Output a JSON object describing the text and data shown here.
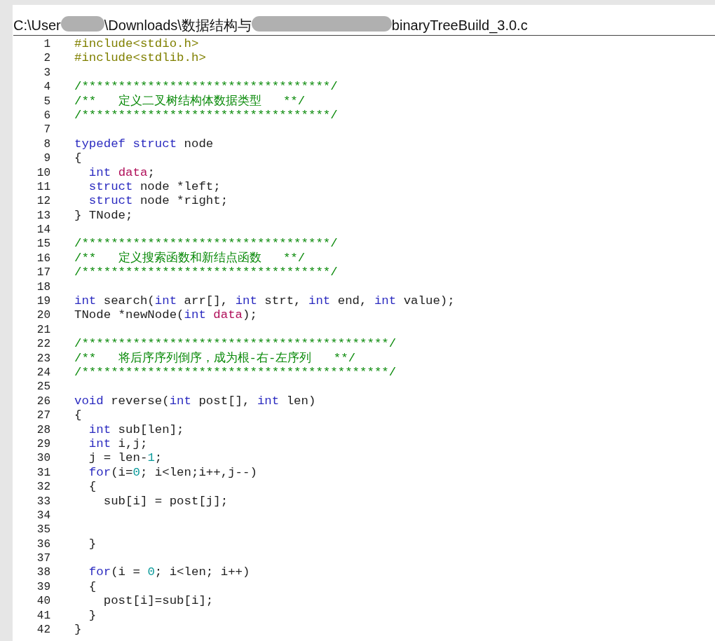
{
  "file_path": {
    "parts": [
      {
        "kind": "text",
        "text": "C:\\User"
      },
      {
        "kind": "redacted"
      },
      {
        "kind": "text",
        "text": "\\Downloads\\数据结构与"
      },
      {
        "kind": "redacted"
      },
      {
        "kind": "text",
        "text": "binaryTreeBuild_3.0.c"
      }
    ]
  },
  "code": {
    "lines": [
      {
        "number": "1",
        "tokens": [
          {
            "kind": "preprocessor",
            "text": "#include<stdio.h>"
          }
        ]
      },
      {
        "number": "2",
        "tokens": [
          {
            "kind": "preprocessor",
            "text": "#include<stdlib.h>"
          }
        ]
      },
      {
        "number": "3"
      },
      {
        "number": "4",
        "tokens": [
          {
            "kind": "comment",
            "text": "/**********************************/"
          }
        ]
      },
      {
        "number": "5",
        "tokens": [
          {
            "kind": "comment",
            "text": "/**   定义二叉树结构体数据类型   **/"
          }
        ]
      },
      {
        "number": "6",
        "tokens": [
          {
            "kind": "comment",
            "text": "/**********************************/"
          }
        ]
      },
      {
        "number": "7"
      },
      {
        "number": "8",
        "tokens": [
          {
            "kind": "keyword",
            "text": "typedef "
          },
          {
            "kind": "keyword",
            "text": "struct"
          },
          {
            "kind": "plain",
            "text": " node"
          }
        ]
      },
      {
        "number": "9",
        "tokens": [
          {
            "kind": "plain",
            "text": "{"
          }
        ]
      },
      {
        "number": "10",
        "tokens": [
          {
            "kind": "keyword",
            "text": "  int "
          },
          {
            "kind": "identifier",
            "text": "data"
          },
          {
            "kind": "plain",
            "text": ";"
          }
        ]
      },
      {
        "number": "11",
        "tokens": [
          {
            "kind": "keyword",
            "text": "  struct"
          },
          {
            "kind": "plain",
            "text": " node *left;"
          }
        ]
      },
      {
        "number": "12",
        "tokens": [
          {
            "kind": "keyword",
            "text": "  struct"
          },
          {
            "kind": "plain",
            "text": " node *right;"
          }
        ]
      },
      {
        "number": "13",
        "tokens": [
          {
            "kind": "plain",
            "text": "} TNode;"
          }
        ]
      },
      {
        "number": "14"
      },
      {
        "number": "15",
        "tokens": [
          {
            "kind": "comment",
            "text": "/**********************************/"
          }
        ]
      },
      {
        "number": "16",
        "tokens": [
          {
            "kind": "comment",
            "text": "/**   定义搜索函数和新结点函数   **/"
          }
        ]
      },
      {
        "number": "17",
        "tokens": [
          {
            "kind": "comment",
            "text": "/**********************************/"
          }
        ]
      },
      {
        "number": "18"
      },
      {
        "number": "19",
        "tokens": [
          {
            "kind": "keyword",
            "text": "int"
          },
          {
            "kind": "plain",
            "text": " search("
          },
          {
            "kind": "keyword",
            "text": "int"
          },
          {
            "kind": "plain",
            "text": " arr[], "
          },
          {
            "kind": "keyword",
            "text": "int"
          },
          {
            "kind": "plain",
            "text": " strt, "
          },
          {
            "kind": "keyword",
            "text": "int"
          },
          {
            "kind": "plain",
            "text": " end, "
          },
          {
            "kind": "keyword",
            "text": "int"
          },
          {
            "kind": "plain",
            "text": " value);"
          }
        ]
      },
      {
        "number": "20",
        "tokens": [
          {
            "kind": "plain",
            "text": "TNode *newNode("
          },
          {
            "kind": "keyword",
            "text": "int "
          },
          {
            "kind": "identifier",
            "text": "data"
          },
          {
            "kind": "plain",
            "text": ");"
          }
        ]
      },
      {
        "number": "21"
      },
      {
        "number": "22",
        "tokens": [
          {
            "kind": "comment",
            "text": "/******************************************/"
          }
        ]
      },
      {
        "number": "23",
        "tokens": [
          {
            "kind": "comment",
            "text": "/**   将后序序列倒序，成为根-右-左序列   **/"
          }
        ]
      },
      {
        "number": "24",
        "tokens": [
          {
            "kind": "comment",
            "text": "/******************************************/"
          }
        ]
      },
      {
        "number": "25"
      },
      {
        "number": "26",
        "tokens": [
          {
            "kind": "keyword",
            "text": "void"
          },
          {
            "kind": "plain",
            "text": " reverse("
          },
          {
            "kind": "keyword",
            "text": "int"
          },
          {
            "kind": "plain",
            "text": " post[], "
          },
          {
            "kind": "keyword",
            "text": "int"
          },
          {
            "kind": "plain",
            "text": " len)"
          }
        ]
      },
      {
        "number": "27",
        "tokens": [
          {
            "kind": "plain",
            "text": "{"
          }
        ]
      },
      {
        "number": "28",
        "tokens": [
          {
            "kind": "keyword",
            "text": "  int"
          },
          {
            "kind": "plain",
            "text": " sub[len];"
          }
        ]
      },
      {
        "number": "29",
        "tokens": [
          {
            "kind": "keyword",
            "text": "  int"
          },
          {
            "kind": "plain",
            "text": " i,j;"
          }
        ]
      },
      {
        "number": "30",
        "tokens": [
          {
            "kind": "plain",
            "text": "  j = len-"
          },
          {
            "kind": "number",
            "text": "1"
          },
          {
            "kind": "plain",
            "text": ";"
          }
        ]
      },
      {
        "number": "31",
        "tokens": [
          {
            "kind": "keyword",
            "text": "  for"
          },
          {
            "kind": "plain",
            "text": "(i="
          },
          {
            "kind": "number",
            "text": "0"
          },
          {
            "kind": "plain",
            "text": "; i<len;i++,j--)"
          }
        ]
      },
      {
        "number": "32",
        "tokens": [
          {
            "kind": "plain",
            "text": "  {"
          }
        ]
      },
      {
        "number": "33",
        "tokens": [
          {
            "kind": "plain",
            "text": "    sub[i] = post[j];"
          }
        ]
      },
      {
        "number": "34"
      },
      {
        "number": "35"
      },
      {
        "number": "36",
        "tokens": [
          {
            "kind": "plain",
            "text": "  }"
          }
        ]
      },
      {
        "number": "37"
      },
      {
        "number": "38",
        "tokens": [
          {
            "kind": "keyword",
            "text": "  for"
          },
          {
            "kind": "plain",
            "text": "(i = "
          },
          {
            "kind": "number",
            "text": "0"
          },
          {
            "kind": "plain",
            "text": "; i<len; i++)"
          }
        ]
      },
      {
        "number": "39",
        "tokens": [
          {
            "kind": "plain",
            "text": "  {"
          }
        ]
      },
      {
        "number": "40",
        "tokens": [
          {
            "kind": "plain",
            "text": "    post[i]=sub[i];"
          }
        ]
      },
      {
        "number": "41",
        "tokens": [
          {
            "kind": "plain",
            "text": "  }"
          }
        ]
      },
      {
        "number": "42",
        "tokens": [
          {
            "kind": "plain",
            "text": "}"
          }
        ]
      }
    ]
  }
}
